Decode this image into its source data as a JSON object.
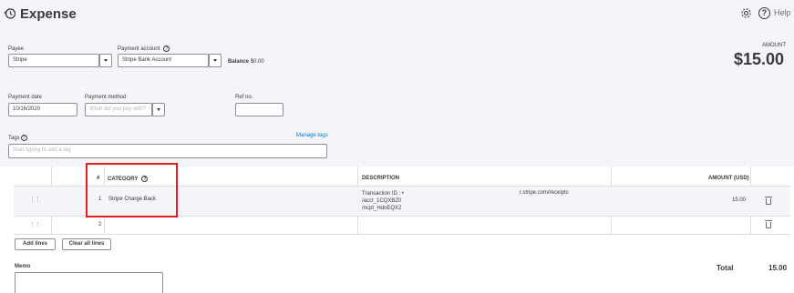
{
  "header": {
    "title": "Expense",
    "icon": "history-icon",
    "settings_icon": "gear-icon",
    "help_label": "Help"
  },
  "payee": {
    "label": "Payee",
    "value": "Stripe"
  },
  "payment_account": {
    "label": "Payment account",
    "value": "Stripe Bank Account"
  },
  "balance": {
    "label": "Balance",
    "value": "$0.00"
  },
  "amount": {
    "label": "AMOUNT",
    "value": "$15.00"
  },
  "payment_date": {
    "label": "Payment date",
    "value": "10/16/2020"
  },
  "payment_method": {
    "label": "Payment method",
    "placeholder": "What did you pay with?"
  },
  "ref_no": {
    "label": "Ref no.",
    "value": ""
  },
  "tags": {
    "label": "Tags",
    "placeholder": "Start typing to add a tag",
    "manage_label": "Manage tags"
  },
  "table": {
    "headers": {
      "num": "#",
      "category": "CATEGORY",
      "description": "DESCRIPTION",
      "amount": "AMOUNT (USD)"
    },
    "rows": [
      {
        "num": "1",
        "category": "Stripe Charge Back",
        "description_lines": [
          "Transaction ID : •",
          "/acct_1CQXBZ0",
          "/ncpt_HdnEQX2"
        ],
        "description_right": "r.stripe.com/receipts",
        "amount": "15.00"
      },
      {
        "num": "2",
        "category": "",
        "description_lines": [],
        "description_right": "",
        "amount": ""
      }
    ]
  },
  "buttons": {
    "add_lines": "Add lines",
    "clear_all_lines": "Clear all lines"
  },
  "memo": {
    "label": "Memo"
  },
  "total": {
    "label": "Total",
    "value": "15.00"
  },
  "colors": {
    "background": "#f4f5f8",
    "highlight_box": "#e02020",
    "link": "#0077c5"
  }
}
